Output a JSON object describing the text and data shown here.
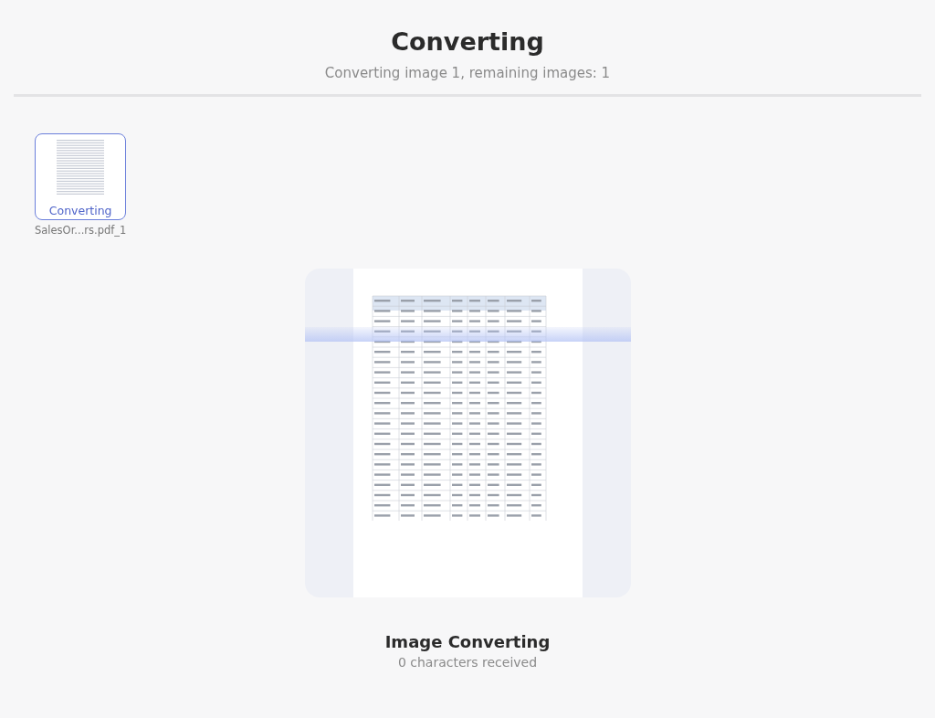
{
  "header": {
    "title": "Converting",
    "subtitle": "Converting image 1, remaining images: 1"
  },
  "files": [
    {
      "name": "SalesOr...rs.pdf_1",
      "status": "Converting",
      "selected": true
    }
  ],
  "preview": {
    "title": "Image Converting",
    "detail": "0 characters received"
  }
}
